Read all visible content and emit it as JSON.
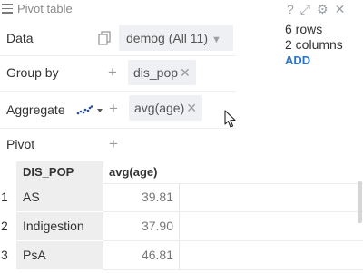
{
  "header": {
    "title": "Pivot table",
    "icons": [
      "help-icon",
      "expand-icon",
      "gear-icon",
      "close-icon"
    ],
    "help_glyph": "?",
    "expand_glyph": "⤢",
    "gear_glyph": "⚙",
    "close_glyph": "✕"
  },
  "rows": {
    "data_label": "Data",
    "data_value": "demog (All 11)",
    "group_label": "Group by",
    "group_chip": "dis_pop",
    "aggregate_label": "Aggregate",
    "aggregate_chip": "avg(age)",
    "pivot_label": "Pivot",
    "plus_glyph": "+",
    "remove_glyph": "✕",
    "caret_glyph": "▼"
  },
  "info": {
    "rows_text": "6 rows",
    "columns_text": "2 columns",
    "add_label": "ADD"
  },
  "table": {
    "columns": [
      "DIS_POP",
      "avg(age)"
    ],
    "rows": [
      {
        "num": "1",
        "dis_pop": "AS",
        "avg_age": "39.81"
      },
      {
        "num": "2",
        "dis_pop": "Indigestion",
        "avg_age": "37.90"
      },
      {
        "num": "3",
        "dis_pop": "PsA",
        "avg_age": "46.81"
      }
    ]
  },
  "colors": {
    "accent": "#2a75c8",
    "chip_bg": "#eef0f3",
    "pinned_col_bg": "#eeeeee",
    "agg_icon": "#2a4fa0"
  }
}
